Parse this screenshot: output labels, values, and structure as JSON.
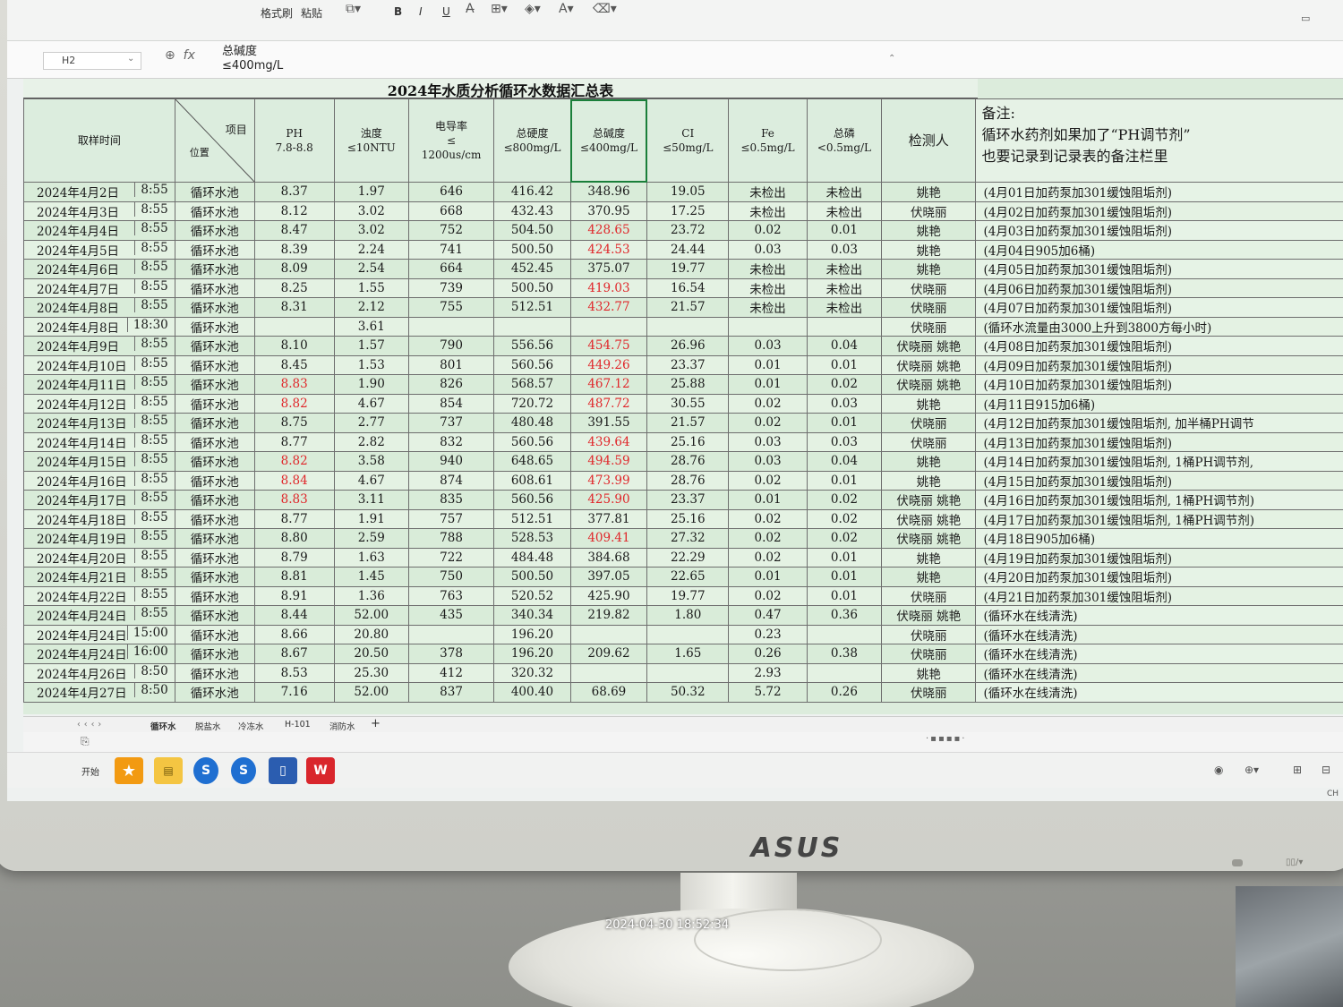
{
  "ribbon": {
    "format_painter": "格式刷",
    "paste": "粘贴",
    "bold": "B",
    "italic": "I",
    "underline": "U"
  },
  "formula_bar": {
    "cell_ref": "H2",
    "formula_line1": "总碱度",
    "formula_line2": "≤400mg/L"
  },
  "sheet_title": "2024年水质分析循环水数据汇总表",
  "headers": {
    "time": "取样时间",
    "item": "项目",
    "position": "位置",
    "ph": "PH",
    "ph_limit": "7.8-8.8",
    "turbidity": "浊度",
    "turbidity_limit": "≤10NTU",
    "conductivity": "电导率",
    "conductivity_le": "≤",
    "conductivity_limit": "1200us/cm",
    "hardness": "总硬度",
    "hardness_limit": "≤800mg/L",
    "alkalinity": "总碱度",
    "alkalinity_limit": "≤400mg/L",
    "cl": "CI",
    "cl_limit": "≤50mg/L",
    "fe": "Fe",
    "fe_limit": "≤0.5mg/L",
    "phosphorus": "总磷",
    "phosphorus_limit": "<0.5mg/L",
    "inspector": "检测人",
    "notes_title": "备注:",
    "notes_line1": "循环水药剂如果加了“PH调节剂”",
    "notes_line2": "也要记录到记录表的备注栏里"
  },
  "rows": [
    {
      "date": "2024年4月2日",
      "time": "8:55",
      "pos": "循环水池",
      "ph": "8.37",
      "turb": "1.97",
      "cond": "646",
      "hard": "416.42",
      "alk": "348.96",
      "cl": "19.05",
      "fe": "未检出",
      "p": "未检出",
      "who": "姚艳",
      "note": "(4月01日加药泵加301缓蚀阻垢剂)"
    },
    {
      "date": "2024年4月3日",
      "time": "8:55",
      "pos": "循环水池",
      "ph": "8.12",
      "turb": "3.02",
      "cond": "668",
      "hard": "432.43",
      "alk": "370.95",
      "cl": "17.25",
      "fe": "未检出",
      "p": "未检出",
      "who": "伏晓丽",
      "note": "(4月02日加药泵加301缓蚀阻垢剂)"
    },
    {
      "date": "2024年4月4日",
      "time": "8:55",
      "pos": "循环水池",
      "ph": "8.47",
      "turb": "3.02",
      "cond": "752",
      "hard": "504.50",
      "alk": "428.65",
      "alk_red": true,
      "cl": "23.72",
      "fe": "0.02",
      "p": "0.01",
      "who": "姚艳",
      "note": "(4月03日加药泵加301缓蚀阻垢剂)"
    },
    {
      "date": "2024年4月5日",
      "time": "8:55",
      "pos": "循环水池",
      "ph": "8.39",
      "turb": "2.24",
      "cond": "741",
      "hard": "500.50",
      "alk": "424.53",
      "alk_red": true,
      "cl": "24.44",
      "fe": "0.03",
      "p": "0.03",
      "who": "姚艳",
      "note": "(4月04日905加6桶)"
    },
    {
      "date": "2024年4月6日",
      "time": "8:55",
      "pos": "循环水池",
      "ph": "8.09",
      "turb": "2.54",
      "cond": "664",
      "hard": "452.45",
      "alk": "375.07",
      "cl": "19.77",
      "fe": "未检出",
      "p": "未检出",
      "who": "姚艳",
      "note": "(4月05日加药泵加301缓蚀阻垢剂)"
    },
    {
      "date": "2024年4月7日",
      "time": "8:55",
      "pos": "循环水池",
      "ph": "8.25",
      "turb": "1.55",
      "cond": "739",
      "hard": "500.50",
      "alk": "419.03",
      "alk_red": true,
      "cl": "16.54",
      "fe": "未检出",
      "p": "未检出",
      "who": "伏晓丽",
      "note": "(4月06日加药泵加301缓蚀阻垢剂)"
    },
    {
      "date": "2024年4月8日",
      "time": "8:55",
      "pos": "循环水池",
      "ph": "8.31",
      "turb": "2.12",
      "cond": "755",
      "hard": "512.51",
      "alk": "432.77",
      "alk_red": true,
      "cl": "21.57",
      "fe": "未检出",
      "p": "未检出",
      "who": "伏晓丽",
      "note": "(4月07日加药泵加301缓蚀阻垢剂)"
    },
    {
      "date": "2024年4月8日",
      "time": "18:30",
      "pos": "循环水池",
      "ph": "",
      "turb": "3.61",
      "cond": "",
      "hard": "",
      "alk": "",
      "cl": "",
      "fe": "",
      "p": "",
      "who": "伏晓丽",
      "note": "(循环水流量由3000上升到3800方每小时)"
    },
    {
      "date": "2024年4月9日",
      "time": "8:55",
      "pos": "循环水池",
      "ph": "8.10",
      "turb": "1.57",
      "cond": "790",
      "hard": "556.56",
      "alk": "454.75",
      "alk_red": true,
      "cl": "26.96",
      "fe": "0.03",
      "p": "0.04",
      "who": "伏晓丽 姚艳",
      "note": "(4月08日加药泵加301缓蚀阻垢剂)"
    },
    {
      "date": "2024年4月10日",
      "time": "8:55",
      "pos": "循环水池",
      "ph": "8.45",
      "turb": "1.53",
      "cond": "801",
      "hard": "560.56",
      "alk": "449.26",
      "alk_red": true,
      "cl": "23.37",
      "fe": "0.01",
      "p": "0.01",
      "who": "伏晓丽 姚艳",
      "note": "(4月09日加药泵加301缓蚀阻垢剂)"
    },
    {
      "date": "2024年4月11日",
      "time": "8:55",
      "pos": "循环水池",
      "ph": "8.83",
      "ph_red": true,
      "turb": "1.90",
      "cond": "826",
      "hard": "568.57",
      "alk": "467.12",
      "alk_red": true,
      "cl": "25.88",
      "fe": "0.01",
      "p": "0.02",
      "who": "伏晓丽 姚艳",
      "note": "(4月10日加药泵加301缓蚀阻垢剂)"
    },
    {
      "date": "2024年4月12日",
      "time": "8:55",
      "pos": "循环水池",
      "ph": "8.82",
      "ph_red": true,
      "turb": "4.67",
      "cond": "854",
      "hard": "720.72",
      "alk": "487.72",
      "alk_red": true,
      "cl": "30.55",
      "fe": "0.02",
      "p": "0.03",
      "who": "姚艳",
      "note": "(4月11日915加6桶)"
    },
    {
      "date": "2024年4月13日",
      "time": "8:55",
      "pos": "循环水池",
      "ph": "8.75",
      "turb": "2.77",
      "cond": "737",
      "hard": "480.48",
      "alk": "391.55",
      "cl": "21.57",
      "fe": "0.02",
      "p": "0.01",
      "who": "伏晓丽",
      "note": "(4月12日加药泵加301缓蚀阻垢剂, 加半桶PH调节"
    },
    {
      "date": "2024年4月14日",
      "time": "8:55",
      "pos": "循环水池",
      "ph": "8.77",
      "turb": "2.82",
      "cond": "832",
      "hard": "560.56",
      "alk": "439.64",
      "alk_red": true,
      "cl": "25.16",
      "fe": "0.03",
      "p": "0.03",
      "who": "伏晓丽",
      "note": "(4月13日加药泵加301缓蚀阻垢剂)"
    },
    {
      "date": "2024年4月15日",
      "time": "8:55",
      "pos": "循环水池",
      "ph": "8.82",
      "ph_red": true,
      "turb": "3.58",
      "cond": "940",
      "hard": "648.65",
      "alk": "494.59",
      "alk_red": true,
      "cl": "28.76",
      "fe": "0.03",
      "p": "0.04",
      "who": "姚艳",
      "note": "(4月14日加药泵加301缓蚀阻垢剂, 1桶PH调节剂, "
    },
    {
      "date": "2024年4月16日",
      "time": "8:55",
      "pos": "循环水池",
      "ph": "8.84",
      "ph_red": true,
      "turb": "4.67",
      "cond": "874",
      "hard": "608.61",
      "alk": "473.99",
      "alk_red": true,
      "cl": "28.76",
      "fe": "0.02",
      "p": "0.01",
      "who": "姚艳",
      "note": "(4月15日加药泵加301缓蚀阻垢剂)"
    },
    {
      "date": "2024年4月17日",
      "time": "8:55",
      "pos": "循环水池",
      "ph": "8.83",
      "ph_red": true,
      "turb": "3.11",
      "cond": "835",
      "hard": "560.56",
      "alk": "425.90",
      "alk_red": true,
      "cl": "23.37",
      "fe": "0.01",
      "p": "0.02",
      "who": "伏晓丽 姚艳",
      "note": "(4月16日加药泵加301缓蚀阻垢剂, 1桶PH调节剂)"
    },
    {
      "date": "2024年4月18日",
      "time": "8:55",
      "pos": "循环水池",
      "ph": "8.77",
      "turb": "1.91",
      "cond": "757",
      "hard": "512.51",
      "alk": "377.81",
      "cl": "25.16",
      "fe": "0.02",
      "p": "0.02",
      "who": "伏晓丽 姚艳",
      "note": "(4月17日加药泵加301缓蚀阻垢剂, 1桶PH调节剂)"
    },
    {
      "date": "2024年4月19日",
      "time": "8:55",
      "pos": "循环水池",
      "ph": "8.80",
      "turb": "2.59",
      "cond": "788",
      "hard": "528.53",
      "alk": "409.41",
      "alk_red": true,
      "cl": "27.32",
      "fe": "0.02",
      "p": "0.02",
      "who": "伏晓丽 姚艳",
      "note": "(4月18日905加6桶)"
    },
    {
      "date": "2024年4月20日",
      "time": "8:55",
      "pos": "循环水池",
      "ph": "8.79",
      "turb": "1.63",
      "cond": "722",
      "hard": "484.48",
      "alk": "384.68",
      "cl": "22.29",
      "fe": "0.02",
      "p": "0.01",
      "who": "姚艳",
      "note": "(4月19日加药泵加301缓蚀阻垢剂)"
    },
    {
      "date": "2024年4月21日",
      "time": "8:55",
      "pos": "循环水池",
      "ph": "8.81",
      "turb": "1.45",
      "cond": "750",
      "hard": "500.50",
      "alk": "397.05",
      "cl": "22.65",
      "fe": "0.01",
      "p": "0.01",
      "who": "姚艳",
      "note": "(4月20日加药泵加301缓蚀阻垢剂)"
    },
    {
      "date": "2024年4月22日",
      "time": "8:55",
      "pos": "循环水池",
      "ph": "8.91",
      "turb": "1.36",
      "cond": "763",
      "hard": "520.52",
      "alk": "425.90",
      "cl": "19.77",
      "fe": "0.02",
      "p": "0.01",
      "who": "伏晓丽",
      "note": "(4月21日加药泵加301缓蚀阻垢剂)"
    },
    {
      "date": "2024年4月24日",
      "time": "8:55",
      "pos": "循环水池",
      "ph": "8.44",
      "turb": "52.00",
      "cond": "435",
      "hard": "340.34",
      "alk": "219.82",
      "cl": "1.80",
      "fe": "0.47",
      "p": "0.36",
      "who": "伏晓丽 姚艳",
      "note": "(循环水在线清洗)"
    },
    {
      "date": "2024年4月24日",
      "time": "15:00",
      "pos": "循环水池",
      "ph": "8.66",
      "turb": "20.80",
      "cond": "",
      "hard": "196.20",
      "alk": "",
      "cl": "",
      "fe": "0.23",
      "p": "",
      "who": "伏晓丽",
      "note": "(循环水在线清洗)"
    },
    {
      "date": "2024年4月24日",
      "time": "16:00",
      "pos": "循环水池",
      "ph": "8.67",
      "turb": "20.50",
      "cond": "378",
      "hard": "196.20",
      "alk": "209.62",
      "cl": "1.65",
      "fe": "0.26",
      "p": "0.38",
      "who": "伏晓丽",
      "note": "(循环水在线清洗)"
    },
    {
      "date": "2024年4月26日",
      "time": "8:50",
      "pos": "循环水池",
      "ph": "8.53",
      "turb": "25.30",
      "cond": "412",
      "hard": "320.32",
      "alk": "",
      "cl": "",
      "fe": "2.93",
      "p": "",
      "who": "姚艳",
      "note": "(循环水在线清洗)"
    },
    {
      "date": "2024年4月27日",
      "time": "8:50",
      "pos": "循环水池",
      "ph": "7.16",
      "turb": "52.00",
      "cond": "837",
      "hard": "400.40",
      "alk": "68.69",
      "cl": "50.32",
      "fe": "5.72",
      "p": "0.26",
      "who": "伏晓丽",
      "note": "(循环水在线清洗)"
    }
  ],
  "sheet_tabs": [
    "循环水",
    "脱盐水",
    "冷冻水",
    "H-101",
    "消防水"
  ],
  "taskbar": {
    "start": "开始"
  },
  "tray": {
    "lang": "CH"
  },
  "monitor": {
    "brand": "ASUS"
  },
  "photo_timestamp": "2024-04-30 18:52:34"
}
